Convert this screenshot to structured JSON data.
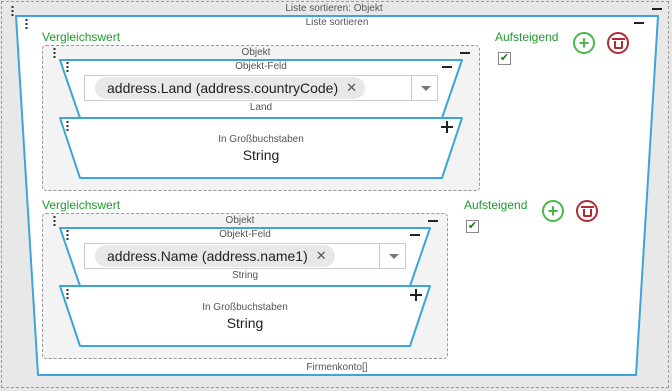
{
  "outer": {
    "title": "Liste sortieren: Objekt"
  },
  "sort": {
    "title": "Liste sortieren",
    "footer": "Firmenkonto[]",
    "criteria": [
      {
        "section_label": "Vergleichswert",
        "ascending_label": "Aufsteigend",
        "ascending_checked": true,
        "object_label": "Objekt",
        "field_label": "Objekt-Feld",
        "field_value": "address.Land (address.countryCode)",
        "field_type": "Land",
        "func_label": "In Großbuchstaben",
        "func_type": "String"
      },
      {
        "section_label": "Vergleichswert",
        "ascending_label": "Aufsteigend",
        "ascending_checked": true,
        "object_label": "Objekt",
        "field_label": "Objekt-Feld",
        "field_value": "address.Name (address.name1)",
        "field_type": "String",
        "func_label": "In Großbuchstaben",
        "func_type": "String"
      }
    ]
  },
  "icons": {
    "add": "plus-circle-icon",
    "delete": "trash-icon",
    "remove_chip": "close-icon",
    "dropdown": "chevron-down-icon",
    "check": "checkmark-icon",
    "drag": "drag-handle-icon",
    "collapse": "minus-icon",
    "expand": "plus-icon"
  },
  "colors": {
    "block_border": "#3da5d9",
    "accent_green": "#1f9a2e",
    "delete_red": "#b02a37"
  }
}
